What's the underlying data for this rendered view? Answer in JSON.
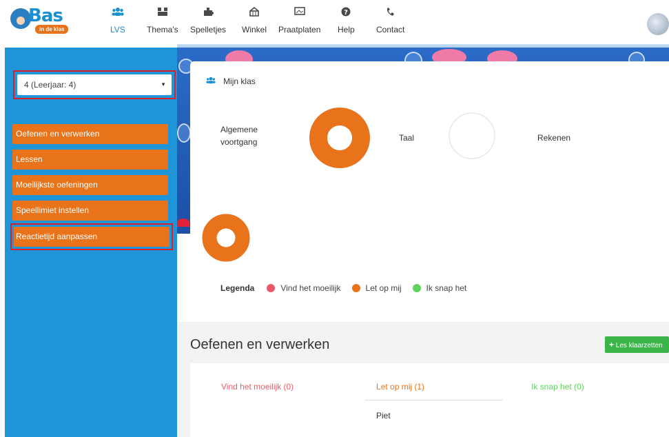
{
  "brand": {
    "name": "Bas",
    "tagline": "in de klas"
  },
  "nav": [
    {
      "key": "lvs",
      "label": "LVS",
      "icon": "users-icon",
      "glyph": "👥",
      "active": true
    },
    {
      "key": "themas",
      "label": "Thema's",
      "icon": "blocks-icon",
      "glyph": "▞"
    },
    {
      "key": "spelletjes",
      "label": "Spelletjes",
      "icon": "puzzle-icon",
      "glyph": "✚"
    },
    {
      "key": "winkel",
      "label": "Winkel",
      "icon": "basket-icon",
      "glyph": "⌂"
    },
    {
      "key": "praatplaten",
      "label": "Praatplaten",
      "icon": "picture-icon",
      "glyph": "▭"
    },
    {
      "key": "help",
      "label": "Help",
      "icon": "question-icon",
      "glyph": "?"
    },
    {
      "key": "contact",
      "label": "Contact",
      "icon": "phone-icon",
      "glyph": "✆"
    }
  ],
  "sidebar": {
    "select": {
      "value": "4 (Leerjaar: 4)"
    },
    "items": [
      {
        "label": "Oefenen en verwerken"
      },
      {
        "label": "Lessen"
      },
      {
        "label": "Moeilijkste oefeningen"
      },
      {
        "label": "Speellimiet instellen"
      },
      {
        "label": "Reactietijd aanpassen"
      }
    ]
  },
  "card": {
    "title": "Mijn klas",
    "metrics": [
      {
        "label": "Algemene voortgang",
        "progress": 1.0,
        "color": "#e8731a"
      },
      {
        "label": "Taal",
        "progress": 0.0,
        "color": "#e8731a"
      },
      {
        "label": "Rekenen",
        "progress": 1.0,
        "color": "#e8731a"
      }
    ],
    "legend": {
      "title": "Legenda",
      "items": [
        {
          "label": "Vind het moeilijk",
          "color": "#ea5a6a"
        },
        {
          "label": "Let op mij",
          "color": "#e8731a"
        },
        {
          "label": "Ik snap het",
          "color": "#5fd35c"
        }
      ]
    }
  },
  "section": {
    "title": "Oefenen en verwerken",
    "add_button": "Les klaarzetten",
    "columns": [
      {
        "label": "Vind het moeilijk (0)",
        "color": "#ea5a6a"
      },
      {
        "label": "Let op mij (1)",
        "color": "#e8731a"
      },
      {
        "label": "Ik snap het (0)",
        "color": "#5fd35c"
      }
    ],
    "students_let_op_mij": [
      "Piet"
    ]
  }
}
